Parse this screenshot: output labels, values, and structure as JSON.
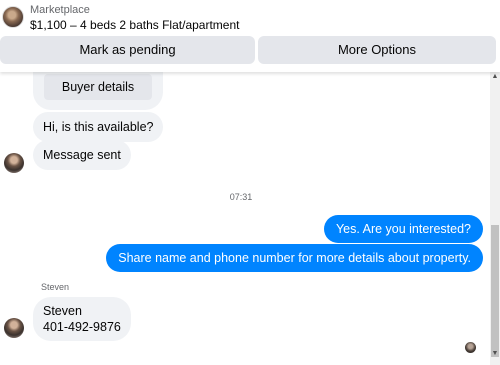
{
  "header": {
    "marketplace_label": "Marketplace",
    "listing_title": "$1,100 – 4 beds 2 baths Flat/apartment",
    "mark_pending_label": "Mark as pending",
    "more_options_label": "More Options"
  },
  "thread": {
    "buyer_details_label": "Buyer details",
    "messages": [
      {
        "from": "buyer",
        "text": "Hi, is this available?"
      },
      {
        "from": "buyer",
        "text": "Message sent"
      },
      {
        "from": "seller",
        "text": "Yes. Are you interested?"
      },
      {
        "from": "seller",
        "text": "Share name and phone number for more details about property."
      }
    ],
    "timestamp": "07:31",
    "sender_name": "Steven",
    "contact_message": {
      "name_line": "Steven",
      "phone_line": "401-492-9876"
    }
  },
  "icons": {
    "header_avatar": "seller-avatar-icon",
    "buyer_avatar": "buyer-avatar-icon",
    "read_receipt": "read-receipt-avatar-icon",
    "scroll_up": "chevron-up-icon",
    "scroll_down": "chevron-down-icon"
  },
  "colors": {
    "outgoing_bubble": "#0084ff",
    "incoming_bubble": "#f0f2f5",
    "button_bg": "#e4e6eb"
  }
}
